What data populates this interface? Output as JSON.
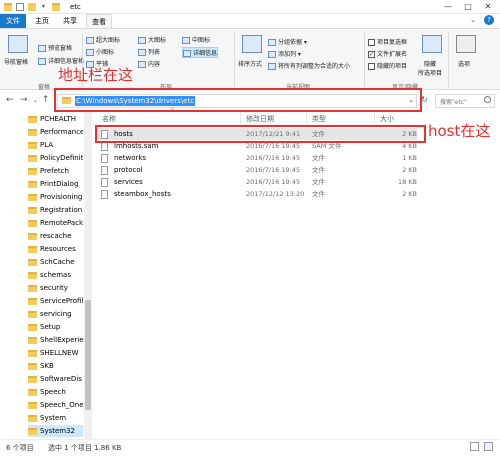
{
  "window": {
    "title": "etc",
    "minimize": "—",
    "maximize": "□",
    "close": "✕",
    "help": "?"
  },
  "tabs": [
    "文件",
    "主页",
    "共享",
    "查看"
  ],
  "ribbon": {
    "nav_pane": "导航窗格",
    "preview_pane": "预览窗格",
    "details_pane": "详细信息窗格",
    "group_panes": "窗格",
    "layout_items": [
      "超大图标",
      "大图标",
      "中图标",
      "小图标",
      "列表",
      "详细信息",
      "平铺",
      "内容"
    ],
    "group_layout": "布局",
    "sort_by": "排序方式",
    "group_by": "分组依据",
    "add_columns": "添加列",
    "fit_columns": "将所有列调整为合适的大小",
    "group_current_view": "当前视图",
    "item_checkboxes": "项目复选框",
    "file_extensions": "文件扩展名",
    "hidden_items": "隐藏的项目",
    "hide_selected": "隐藏",
    "hide_selected_2": "所选项目",
    "group_show_hide": "显示/隐藏",
    "options": "选项",
    "checks": {
      "item_checkboxes": false,
      "file_extensions": true,
      "hidden_items": false
    }
  },
  "address": {
    "path": "C:\\Windows\\System32\\drivers\\etc",
    "search_placeholder": "搜索\"etc\"",
    "back": "←",
    "forward": "→",
    "up": "↑",
    "dropdown": "⌄",
    "refresh": "↻",
    "search_icon": "search-icon"
  },
  "annotations": {
    "address_note": "地址栏在这",
    "host_note": "host在这"
  },
  "columns": [
    "名称",
    "修改日期",
    "类型",
    "大小"
  ],
  "files": [
    {
      "name": "hosts",
      "date": "2017/12/21 9:41",
      "type": "文件",
      "size": "2 KB"
    },
    {
      "name": "lmhosts.sam",
      "date": "2016/7/16 19:45",
      "type": "SAM 文件",
      "size": "4 KB"
    },
    {
      "name": "networks",
      "date": "2016/7/16 19:45",
      "type": "文件",
      "size": "1 KB"
    },
    {
      "name": "protocol",
      "date": "2016/7/16 19:45",
      "type": "文件",
      "size": "2 KB"
    },
    {
      "name": "services",
      "date": "2016/7/16 19:45",
      "type": "文件",
      "size": "18 KB"
    },
    {
      "name": "steambox_hosts",
      "date": "2017/12/12 13:20",
      "type": "文件",
      "size": "2 KB"
    }
  ],
  "nav_items": [
    "PCHEALTH",
    "Performance",
    "PLA",
    "PolicyDefinit",
    "Prefetch",
    "PrintDialog",
    "Provisioning",
    "Registration",
    "RemotePack",
    "rescache",
    "Resources",
    "SchCache",
    "schemas",
    "security",
    "ServiceProfil",
    "servicing",
    "Setup",
    "ShellExperie",
    "SHELLNEW",
    "SKB",
    "SoftwareDis",
    "Speech",
    "Speech_One",
    "System",
    "System32"
  ],
  "status": {
    "count": "6 个项目",
    "selected": "选中 1 个项目  1.86 KB"
  }
}
